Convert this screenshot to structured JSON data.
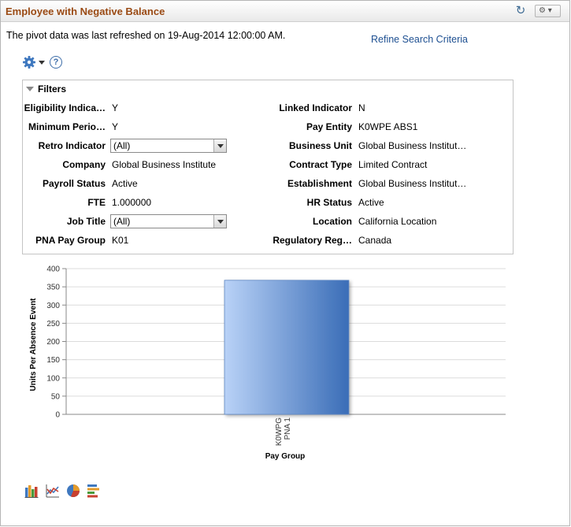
{
  "pagelet": {
    "title": "Employee with Negative Balance",
    "refresh_icon": "refresh-icon",
    "menu_icon": "gear-icon"
  },
  "note": "The pivot data was last refreshed on 19-Aug-2014 12:00:00 AM.",
  "refine_link": "Refine Search Criteria",
  "filters": {
    "title": "Filters",
    "left": [
      {
        "label": "Eligibility Indica…",
        "value": "Y"
      },
      {
        "label": "Minimum Perio…",
        "value": "Y"
      },
      {
        "label": "Retro Indicator",
        "value": "(All)",
        "type": "select"
      },
      {
        "label": "Company",
        "value": "Global Business Institute"
      },
      {
        "label": "Payroll Status",
        "value": "Active"
      },
      {
        "label": "FTE",
        "value": "1.000000"
      },
      {
        "label": "Job Title",
        "value": "(All)",
        "type": "select"
      },
      {
        "label": "PNA Pay Group",
        "value": "K01"
      }
    ],
    "right": [
      {
        "label": "Linked Indicator",
        "value": "N"
      },
      {
        "label": "Pay Entity",
        "value": "K0WPE ABS1"
      },
      {
        "label": "Business Unit",
        "value": "Global Business Institut…"
      },
      {
        "label": "Contract Type",
        "value": "Limited Contract"
      },
      {
        "label": "Establishment",
        "value": "Global Business Institut…"
      },
      {
        "label": "HR Status",
        "value": "Active"
      },
      {
        "label": "Location",
        "value": "California Location"
      },
      {
        "label": "Regulatory Reg…",
        "value": "Canada"
      }
    ]
  },
  "chart_data": {
    "type": "bar",
    "categories": [
      "K0WPG PNA1"
    ],
    "category_lines": [
      [
        "K0WPG",
        "PNA 1"
      ]
    ],
    "values": [
      368
    ],
    "xlabel": "Pay Group",
    "ylabel": "Units Per Absence Event",
    "ylim": [
      0,
      400
    ],
    "yticks": [
      0,
      50,
      100,
      150,
      200,
      250,
      300,
      350,
      400
    ],
    "grid": true,
    "bar_color_start": "#b9d2f7",
    "bar_color_end": "#3a6db7"
  },
  "chart_types": [
    "bar-chart-icon",
    "line-chart-icon",
    "pie-chart-icon",
    "horizontal-bar-chart-icon"
  ]
}
